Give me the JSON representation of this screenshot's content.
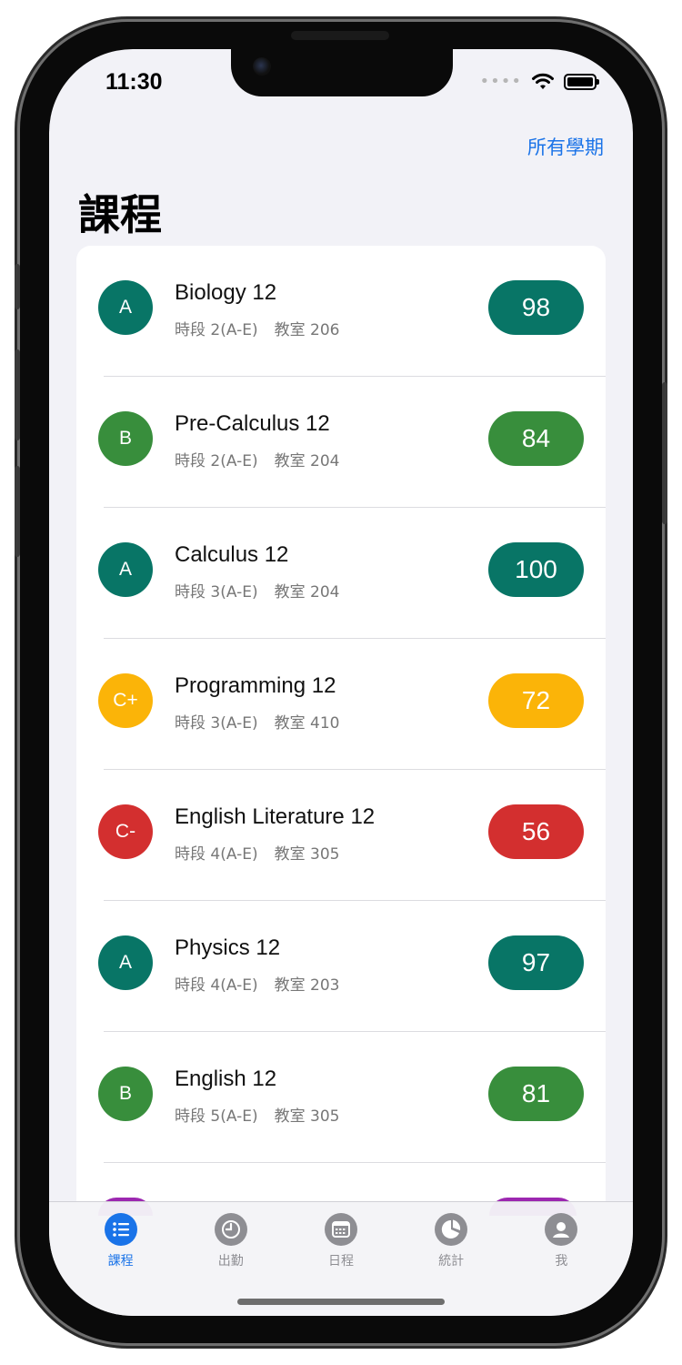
{
  "status_bar": {
    "time": "11:30"
  },
  "header": {
    "semesters_link": "所有學期",
    "title": "課程"
  },
  "courses": [
    {
      "letter": "A",
      "name": "Biology 12",
      "period": "時段 2(A-E)",
      "room": "教室 206",
      "score": "98",
      "color": "#087566"
    },
    {
      "letter": "B",
      "name": "Pre-Calculus 12",
      "period": "時段 2(A-E)",
      "room": "教室 204",
      "score": "84",
      "color": "#388e3c"
    },
    {
      "letter": "A",
      "name": "Calculus 12",
      "period": "時段 3(A-E)",
      "room": "教室 204",
      "score": "100",
      "color": "#087566"
    },
    {
      "letter": "C+",
      "name": "Programming 12",
      "period": "時段 3(A-E)",
      "room": "教室 410",
      "score": "72",
      "color": "#fbb408"
    },
    {
      "letter": "C-",
      "name": "English Literature 12",
      "period": "時段 4(A-E)",
      "room": "教室 305",
      "score": "56",
      "color": "#d32f2f"
    },
    {
      "letter": "A",
      "name": "Physics 12",
      "period": "時段 4(A-E)",
      "room": "教室 203",
      "score": "97",
      "color": "#087566"
    },
    {
      "letter": "B",
      "name": "English 12",
      "period": "時段 5(A-E)",
      "room": "教室 305",
      "score": "81",
      "color": "#388e3c"
    }
  ],
  "peek_color": "#9c27b0",
  "tabs": [
    {
      "label": "課程",
      "icon": "list-icon",
      "active": true
    },
    {
      "label": "出勤",
      "icon": "clock-icon",
      "active": false
    },
    {
      "label": "日程",
      "icon": "calendar-icon",
      "active": false
    },
    {
      "label": "統計",
      "icon": "pie-chart-icon",
      "active": false
    },
    {
      "label": "我",
      "icon": "person-icon",
      "active": false
    }
  ],
  "colors": {
    "accent": "#1a73e8",
    "inactive": "#8e8e93"
  }
}
